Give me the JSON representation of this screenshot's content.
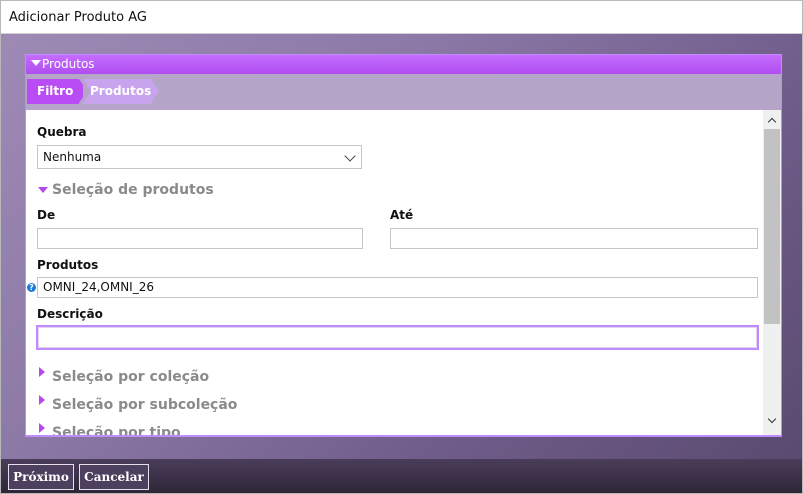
{
  "window": {
    "title": "Adicionar Produto AG"
  },
  "panel": {
    "header": "Produtos"
  },
  "breadcrumb": [
    {
      "label": "Filtro",
      "active": true
    },
    {
      "label": "Produtos",
      "active": false
    }
  ],
  "form": {
    "quebra": {
      "label": "Quebra",
      "value": "Nenhuma"
    },
    "selecao_produtos": {
      "title": "Seleção de produtos",
      "expanded": true
    },
    "de": {
      "label": "De",
      "value": ""
    },
    "ate": {
      "label": "Até",
      "value": ""
    },
    "produtos": {
      "label": "Produtos",
      "value": "OMNI_24,OMNI_26",
      "help_glyph": "?"
    },
    "descricao": {
      "label": "Descrição",
      "value": ""
    },
    "collapsed_sections": [
      {
        "title": "Seleção por coleção"
      },
      {
        "title": "Seleção por subcoleção"
      },
      {
        "title": "Seleção por tipo"
      }
    ]
  },
  "footer": {
    "next_label": "Próximo",
    "cancel_label": "Cancelar"
  },
  "colors": {
    "accent": "#b94cf5",
    "footer": "#3a2f47",
    "help": "#1e7ad8"
  },
  "icons": [
    "chevron-down-icon",
    "triangle-down-icon",
    "triangle-right-icon",
    "help-icon",
    "scroll-up-icon",
    "scroll-down-icon"
  ]
}
